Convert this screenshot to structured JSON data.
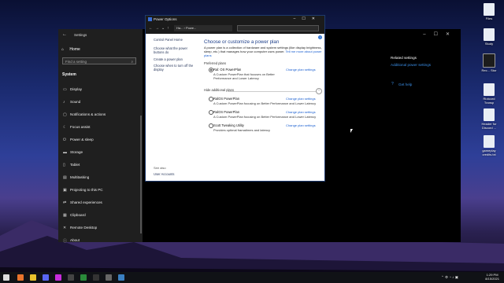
{
  "desktop": {
    "icons": [
      {
        "label": "Files"
      },
      {
        "label": "Study"
      },
      {
        "label": "Rec... Stor"
      },
      {
        "label": "Riotcord Transp"
      },
      {
        "label": "Header for Discord ..."
      },
      {
        "label": "gameplay credits.txt"
      }
    ]
  },
  "settings": {
    "title": "Settings",
    "home": "Home",
    "search_placeholder": "Find a setting",
    "section": "System",
    "nav": [
      "Display",
      "Sound",
      "Notifications & actions",
      "Focus assist",
      "Power & sleep",
      "Storage",
      "Tablet",
      "Multitasking",
      "Projecting to this PC",
      "Shared experiences",
      "Clipboard",
      "Remote Desktop",
      "About"
    ],
    "related_title": "Related settings",
    "related_link": "Additional power settings",
    "get_help": "Get help"
  },
  "power": {
    "window_title": "Power Options",
    "address": "Ha... › Powe...",
    "left": [
      "Control Panel Home",
      "Choose what the power buttons do",
      "Create a power plan",
      "Choose when to turn off the display"
    ],
    "see_also": "See also",
    "user_accounts": "User Accounts",
    "heading": "Choose or customize a power plan",
    "intro": "A power plan is a collection of hardware and system settings (like display brightness, sleep, etc.) that manages how your computer uses power.",
    "intro_link": "Tell me more about power plans",
    "preferred_label": "Preferred plans",
    "hide_label": "Hide additional plans",
    "change_label": "Change plan settings",
    "plans": [
      {
        "name": "Ral: OS PowerPlan",
        "desc": "A Custom PowerPlan that focuses on Better Performance and Lower Latency"
      },
      {
        "name": "RalOS PowerPlan",
        "desc": "A Custom PowerPlan focusing on Better Performance and Lower Latency"
      },
      {
        "name": "RalOS PowerPlan",
        "desc": "A Custom PowerPlan focusing on Better Performance and Lower Latency"
      },
      {
        "name": "Scott Tweaking Utility",
        "desc": "Provides optimal framatimes and latency"
      }
    ]
  },
  "taskbar": {
    "time": "1:29 PM",
    "date": "8/15/2021",
    "colors": {
      "accent": "#3a8ee6",
      "bg": "#101216"
    }
  }
}
